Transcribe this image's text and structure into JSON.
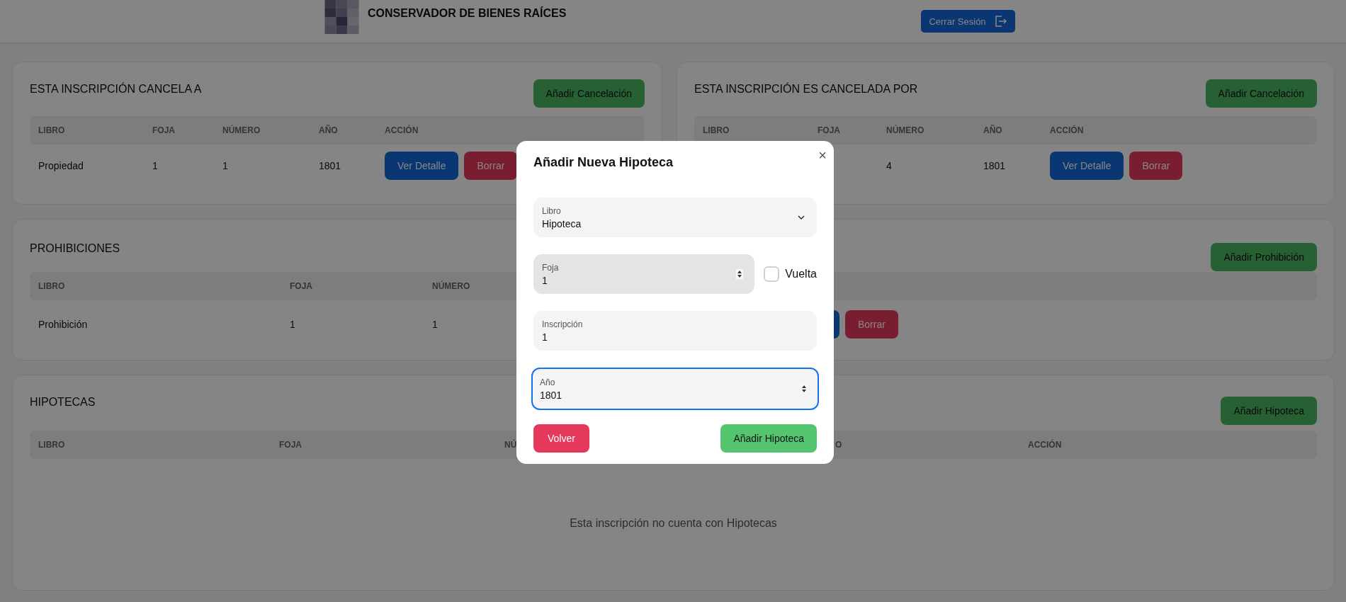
{
  "header": {
    "title": "CONSERVADOR DE BIENES RAÍCES",
    "logout_button": "Cerrar Sesión"
  },
  "cards": [
    {
      "title": "ESTA INSCRIPCIÓN CANCELA A",
      "add_button": "Añadir Cancelación",
      "columns": [
        "LIBRO",
        "FOJA",
        "NÚMERO",
        "AÑO",
        "ACCIÓN"
      ],
      "rows": [
        {
          "libro": "Propiedad",
          "foja": "1",
          "numero": "1",
          "anio": "1801",
          "actions": [
            {
              "kind": "view",
              "label": "Ver Detalle"
            },
            {
              "kind": "delete",
              "label": "Borrar"
            }
          ]
        }
      ]
    },
    {
      "title": "ESTA INSCRIPCIÓN ES CANCELADA POR",
      "add_button": "Añadir Cancelación",
      "columns": [
        "LIBRO",
        "FOJA",
        "NÚMERO",
        "AÑO",
        "ACCIÓN"
      ],
      "rows": [
        {
          "numero": "4",
          "anio": "1801",
          "actions": [
            {
              "kind": "view",
              "label": "Ver Detalle"
            },
            {
              "kind": "delete",
              "label": "Borrar"
            }
          ]
        }
      ]
    },
    {
      "title": "PROHIBICIONES",
      "add_button": "Añadir Prohibición",
      "columns": [
        "LIBRO",
        "FOJA",
        "NÚMERO"
      ],
      "rows": [
        {
          "libro": "Prohibición",
          "foja": "1",
          "numero": "1",
          "actions": [
            {
              "kind": "view"
            },
            {
              "kind": "delete",
              "label": "Borrar"
            }
          ]
        }
      ]
    },
    {
      "title": "HIPOTECAS",
      "add_button": "Añadir Hipoteca",
      "columns": [
        "LIBRO",
        "FOJA",
        "NÚ",
        "O",
        "ACCIÓN"
      ],
      "empty_message": "Esta inscripción no cuenta con Hipotecas"
    }
  ],
  "modal": {
    "title": "Añadir Nueva Hipoteca",
    "close": "×",
    "fields": [
      {
        "kind": "select",
        "label": "Libro",
        "value": "Hipoteca",
        "focused": false,
        "hovered": false
      },
      {
        "kind": "number",
        "label": "Foja",
        "value": "1",
        "focused": false,
        "hovered": true,
        "checkbox": {
          "label": "Vuelta",
          "checked": false
        }
      },
      {
        "kind": "text",
        "label": "Inscripción",
        "value": "1",
        "focused": false,
        "hovered": false
      },
      {
        "kind": "number",
        "label": "Año",
        "value": "1801",
        "focused": true,
        "hovered": false
      }
    ],
    "back_button": "Volver",
    "submit_button": "Añadir Hipoteca"
  }
}
